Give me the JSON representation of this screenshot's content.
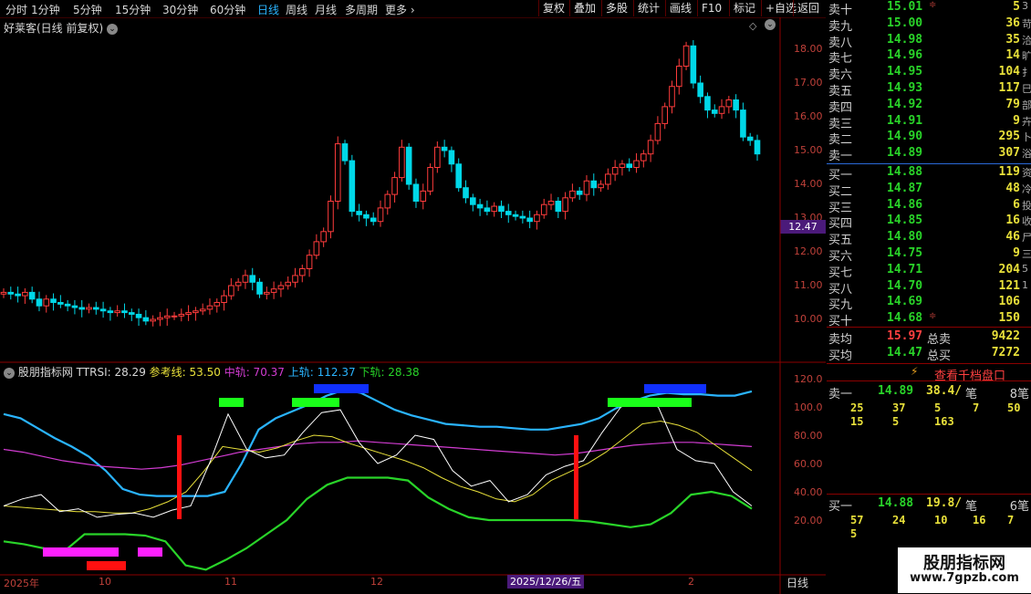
{
  "toolbar": {
    "periods": [
      "分时",
      "1分钟",
      "5分钟",
      "15分钟",
      "30分钟",
      "60分钟",
      "日线",
      "周线",
      "月线",
      "多周期",
      "更多"
    ],
    "active_period": "日线",
    "buttons": [
      "复权",
      "叠加",
      "多股",
      "统计",
      "画线",
      "F10",
      "标记",
      "+自选",
      "返回"
    ]
  },
  "main": {
    "title": "好莱客(日线 前复权)",
    "current_price_tag": "12.47",
    "price_ticks": [
      "18.00",
      "17.00",
      "16.00",
      "15.00",
      "14.00",
      "13.00",
      "12.00",
      "11.00",
      "10.00"
    ]
  },
  "indicator": {
    "title": "股朋指标网",
    "name_value": "TTRSI: 28.29",
    "ref_line": "参考线: 53.50",
    "mid_track": "中轨: 70.37",
    "upper_track": "上轨: 112.37",
    "lower_track": "下轨: 28.38",
    "ticks": [
      "120.0",
      "100.0",
      "80.00",
      "60.00",
      "40.00",
      "20.00"
    ]
  },
  "dates": {
    "labels": [
      "2025年",
      "10",
      "11",
      "12",
      "2",
      "日线"
    ],
    "cursor_date": "2025/12/26/五"
  },
  "colors": {
    "up": "#ff3c3c",
    "down": "#00d8e8",
    "axis": "#8b0000",
    "buy_sell_green": "#29d429",
    "volume_yellow": "#e8e03a"
  },
  "orderbook": {
    "sells": [
      {
        "label": "卖十",
        "price": "15.01",
        "vol": "5",
        "mark": "≑",
        "side": "3"
      },
      {
        "label": "卖九",
        "price": "15.00",
        "vol": "36",
        "side": "苛"
      },
      {
        "label": "卖八",
        "price": "14.98",
        "vol": "35",
        "side": "洽"
      },
      {
        "label": "卖七",
        "price": "14.96",
        "vol": "14",
        "side": "旷"
      },
      {
        "label": "卖六",
        "price": "14.95",
        "vol": "104",
        "side": "扌"
      },
      {
        "label": "卖五",
        "price": "14.93",
        "vol": "117",
        "side": "巳"
      },
      {
        "label": "卖四",
        "price": "14.92",
        "vol": "79",
        "side": "部"
      },
      {
        "label": "卖三",
        "price": "14.91",
        "vol": "9",
        "side": "卉"
      },
      {
        "label": "卖二",
        "price": "14.90",
        "vol": "295",
        "side": "卜"
      },
      {
        "label": "卖一",
        "price": "14.89",
        "vol": "307",
        "side": "浴"
      }
    ],
    "buys": [
      {
        "label": "买一",
        "price": "14.88",
        "vol": "119",
        "side": "资"
      },
      {
        "label": "买二",
        "price": "14.87",
        "vol": "48",
        "side": "冷"
      },
      {
        "label": "买三",
        "price": "14.86",
        "vol": "6",
        "side": "投"
      },
      {
        "label": "买四",
        "price": "14.85",
        "vol": "16",
        "side": "收"
      },
      {
        "label": "买五",
        "price": "14.80",
        "vol": "46",
        "side": "尸"
      },
      {
        "label": "买六",
        "price": "14.75",
        "vol": "9",
        "side": "三"
      },
      {
        "label": "买七",
        "price": "14.71",
        "vol": "204",
        "side": "5"
      },
      {
        "label": "买八",
        "price": "14.70",
        "vol": "121",
        "side": "1"
      },
      {
        "label": "买九",
        "price": "14.69",
        "vol": "106",
        "side": ""
      },
      {
        "label": "买十",
        "price": "14.68",
        "vol": "150",
        "mark": "≑",
        "side": ""
      }
    ],
    "avg_sell_label": "卖均",
    "avg_sell": "15.97",
    "total_sell_label": "总卖",
    "total_sell": "9422",
    "avg_buy_label": "买均",
    "avg_buy": "14.47",
    "total_buy_label": "总买",
    "total_buy": "7272"
  },
  "trade_panel": {
    "link": "查看千档盘口",
    "sell1_label": "卖一",
    "sell1_price": "14.89",
    "sell1_avg": "38.4/",
    "sell1_unit": "笔",
    "sell1_count": "8笔",
    "sell1_rows": [
      [
        "25",
        "37",
        "5",
        "7",
        "50"
      ],
      [
        "15",
        "5",
        "163",
        "",
        ""
      ]
    ],
    "buy1_label": "买一",
    "buy1_price": "14.88",
    "buy1_avg": "19.8/",
    "buy1_unit": "笔",
    "buy1_count": "6笔",
    "buy1_rows": [
      [
        "57",
        "24",
        "10",
        "16",
        "7"
      ],
      [
        "5",
        "",
        "",
        "",
        ""
      ]
    ]
  },
  "watermark": {
    "title": "股朋指标网",
    "url": "www.7gpzb.com"
  }
}
